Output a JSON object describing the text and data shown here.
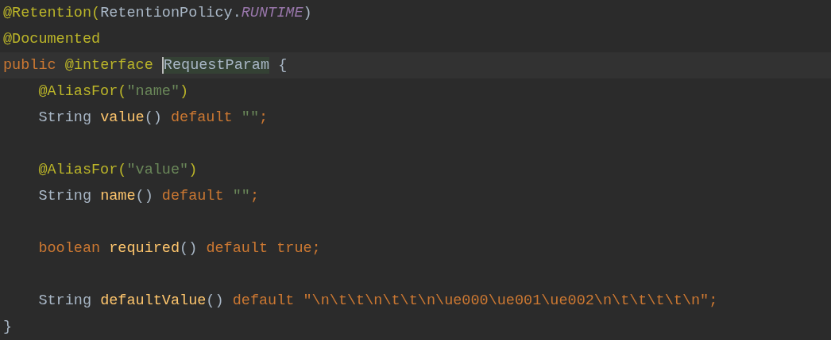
{
  "editor": {
    "lines": [
      {
        "tokens": [
          {
            "text": "@Retention(",
            "kind": "annotation"
          },
          {
            "text": "RetentionPolicy.",
            "kind": "plain"
          },
          {
            "text": "RUNTIME",
            "kind": "constant"
          },
          {
            "text": ")",
            "kind": "plain"
          }
        ]
      },
      {
        "tokens": [
          {
            "text": "@Documented",
            "kind": "annotation"
          }
        ]
      },
      {
        "current": true,
        "tokens": [
          {
            "text": "public ",
            "kind": "keyword"
          },
          {
            "text": "@interface ",
            "kind": "annotation"
          },
          {
            "text": "RequestParam",
            "kind": "plain",
            "caret": true,
            "highlighted": true
          },
          {
            "text": " {",
            "kind": "plain"
          }
        ]
      },
      {
        "tokens": [
          {
            "text": "    @AliasFor(",
            "kind": "annotation"
          },
          {
            "text": "\"name\"",
            "kind": "string"
          },
          {
            "text": ")",
            "kind": "annotation"
          }
        ]
      },
      {
        "tokens": [
          {
            "text": "    String ",
            "kind": "plain"
          },
          {
            "text": "value",
            "kind": "method"
          },
          {
            "text": "() ",
            "kind": "plain"
          },
          {
            "text": "default ",
            "kind": "keyword"
          },
          {
            "text": "\"\"",
            "kind": "string"
          },
          {
            "text": ";",
            "kind": "keyword"
          }
        ]
      },
      {
        "blank_before": true,
        "tokens": [
          {
            "text": "    @AliasFor(",
            "kind": "annotation"
          },
          {
            "text": "\"value\"",
            "kind": "string"
          },
          {
            "text": ")",
            "kind": "annotation"
          }
        ]
      },
      {
        "tokens": [
          {
            "text": "    String ",
            "kind": "plain"
          },
          {
            "text": "name",
            "kind": "method"
          },
          {
            "text": "() ",
            "kind": "plain"
          },
          {
            "text": "default ",
            "kind": "keyword"
          },
          {
            "text": "\"\"",
            "kind": "string"
          },
          {
            "text": ";",
            "kind": "keyword"
          }
        ]
      },
      {
        "blank_before": true,
        "tokens": [
          {
            "text": "    boolean ",
            "kind": "keyword"
          },
          {
            "text": "required",
            "kind": "method"
          },
          {
            "text": "() ",
            "kind": "plain"
          },
          {
            "text": "default true;",
            "kind": "keyword"
          }
        ]
      },
      {
        "blank_before": true,
        "tokens": [
          {
            "text": "    String ",
            "kind": "plain"
          },
          {
            "text": "defaultValue",
            "kind": "method"
          },
          {
            "text": "() ",
            "kind": "plain"
          },
          {
            "text": "default ",
            "kind": "keyword"
          },
          {
            "text": "\"\\n\\t\\t\\n\\t\\t\\n\\ue000\\ue001\\ue002\\n\\t\\t\\t\\t\\n\";",
            "kind": "keyword"
          }
        ]
      },
      {
        "tokens": [
          {
            "text": "}",
            "kind": "plain"
          }
        ]
      }
    ]
  }
}
